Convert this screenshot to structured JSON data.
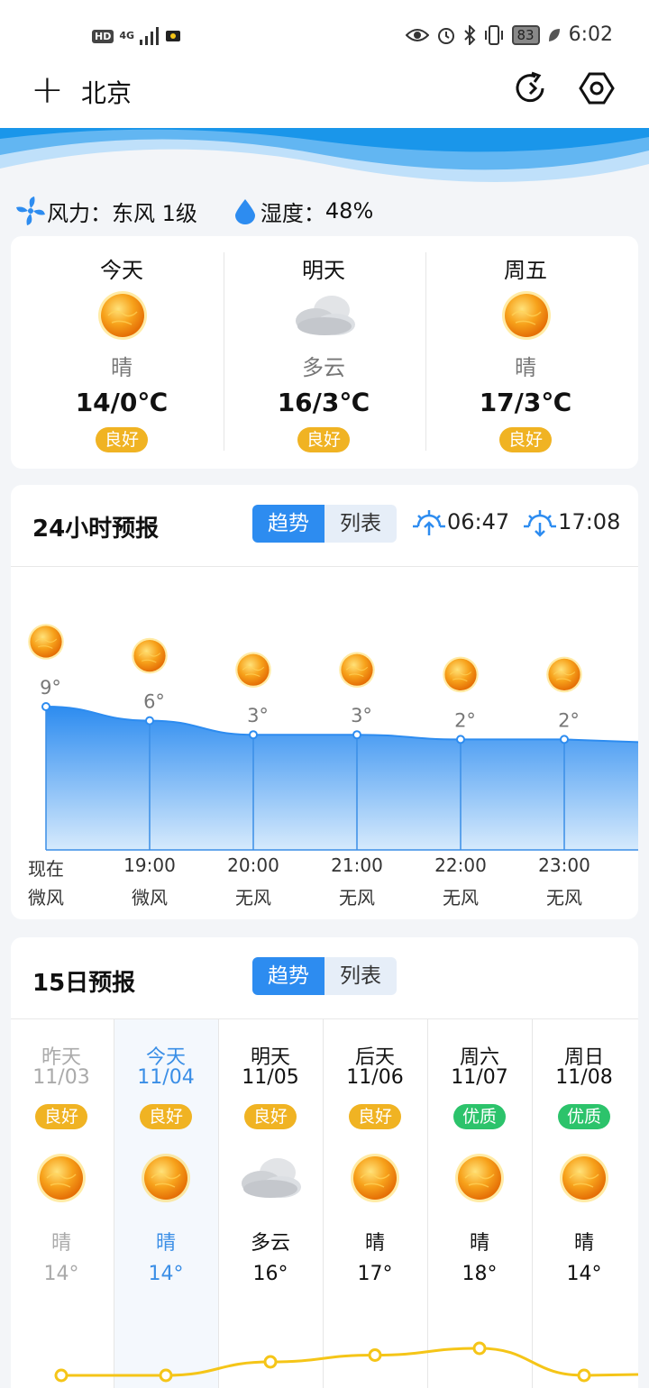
{
  "status": {
    "hd": "HD",
    "net": "4G",
    "battery": "83",
    "time": "6:02"
  },
  "header": {
    "city": "北京"
  },
  "info": {
    "wind_label": "风力：",
    "wind_value": "东风 1级",
    "humidity_label": "湿度：",
    "humidity_value": "48%"
  },
  "days": [
    {
      "name": "今天",
      "cond": "晴",
      "temp": "14/0℃",
      "aqi": "良好",
      "icon": "sun-icon"
    },
    {
      "name": "明天",
      "cond": "多云",
      "temp": "16/3℃",
      "aqi": "良好",
      "icon": "cloud-icon"
    },
    {
      "name": "周五",
      "cond": "晴",
      "temp": "17/3℃",
      "aqi": "良好",
      "icon": "sun-icon"
    }
  ],
  "hourly": {
    "title": "24小时预报",
    "toggle": [
      "趋势",
      "列表"
    ],
    "sunrise": "06:47",
    "sunset": "17:08",
    "items": [
      {
        "time": "现在",
        "wind": "微风",
        "temp": 9,
        "temp_label": "9°"
      },
      {
        "time": "19:00",
        "wind": "微风",
        "temp": 6,
        "temp_label": "6°"
      },
      {
        "time": "20:00",
        "wind": "无风",
        "temp": 3,
        "temp_label": "3°"
      },
      {
        "time": "21:00",
        "wind": "无风",
        "temp": 3,
        "temp_label": "3°"
      },
      {
        "time": "22:00",
        "wind": "无风",
        "temp": 2,
        "temp_label": "2°"
      },
      {
        "time": "23:00",
        "wind": "无风",
        "temp": 2,
        "temp_label": "2°"
      }
    ]
  },
  "daily": {
    "title": "15日预报",
    "toggle": [
      "趋势",
      "列表"
    ],
    "items": [
      {
        "name": "昨天",
        "date": "11/03",
        "aqi": "良好",
        "aqi_level": "good",
        "cond": "晴",
        "temp": "14°",
        "icon": "sun-icon"
      },
      {
        "name": "今天",
        "date": "11/04",
        "aqi": "良好",
        "aqi_level": "good",
        "cond": "晴",
        "temp": "14°",
        "icon": "sun-icon"
      },
      {
        "name": "明天",
        "date": "11/05",
        "aqi": "良好",
        "aqi_level": "good",
        "cond": "多云",
        "temp": "16°",
        "icon": "cloud-icon"
      },
      {
        "name": "后天",
        "date": "11/06",
        "aqi": "良好",
        "aqi_level": "good",
        "cond": "晴",
        "temp": "17°",
        "icon": "sun-icon"
      },
      {
        "name": "周六",
        "date": "11/07",
        "aqi": "优质",
        "aqi_level": "excellent",
        "cond": "晴",
        "temp": "18°",
        "icon": "sun-icon"
      },
      {
        "name": "周日",
        "date": "11/08",
        "aqi": "优质",
        "aqi_level": "excellent",
        "cond": "晴",
        "temp": "14°",
        "icon": "sun-icon"
      }
    ]
  },
  "colors": {
    "accent": "#2d8cf0",
    "aqi_good": "#f0b323",
    "aqi_excellent": "#2cc36b",
    "trend_line": "#f5c518"
  }
}
